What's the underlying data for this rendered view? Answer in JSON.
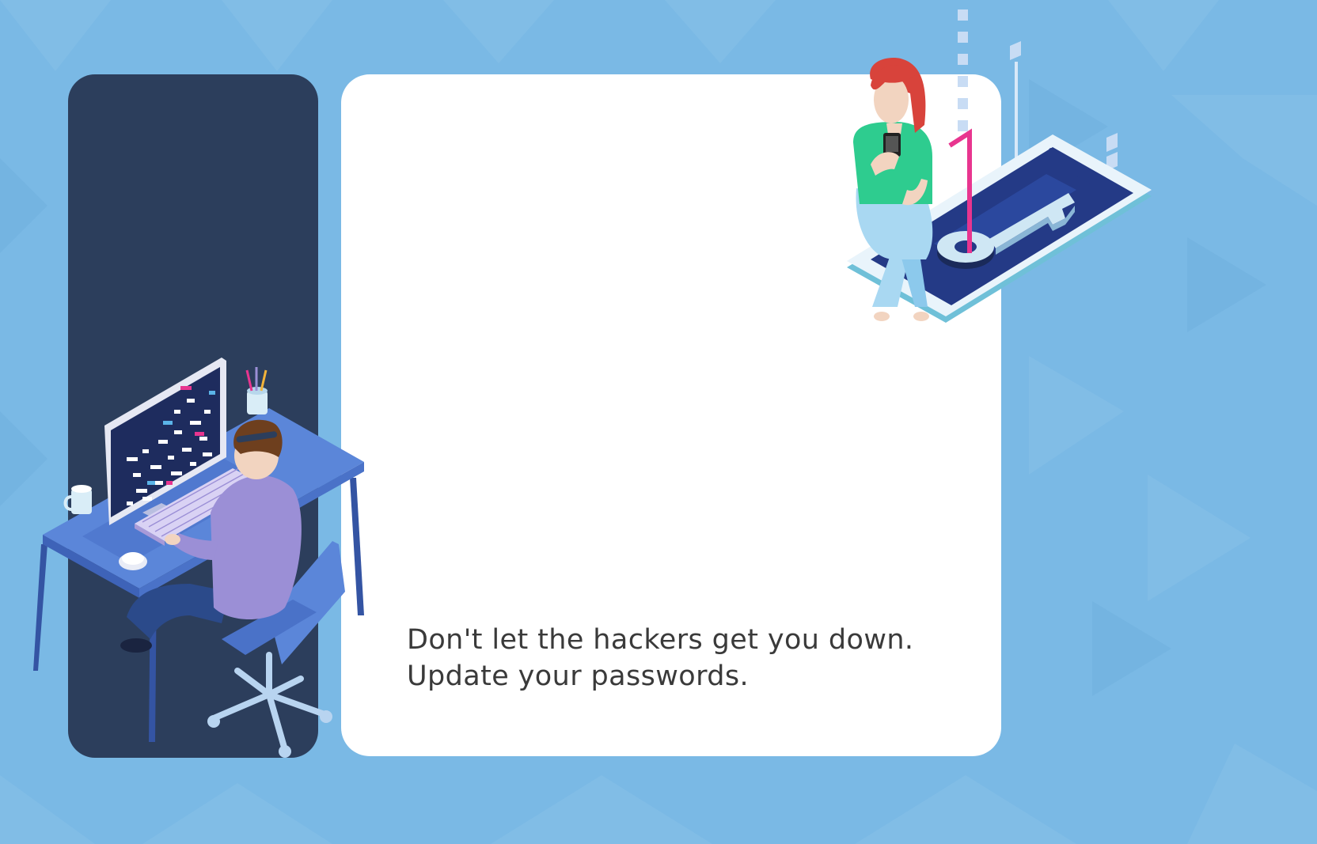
{
  "message": {
    "line1": "Don't let the hackers get you down.",
    "line2": "Update your passwords."
  },
  "colors": {
    "background": "#7ab9e5",
    "panel": "#2c3e5c",
    "card": "#ffffff",
    "text": "#3a3a3a",
    "accent_pink": "#e8358f",
    "shirt_green": "#2ecc8f",
    "jacket_purple": "#9b8fd6"
  },
  "icons": [
    "hacker-desk-illustration",
    "woman-phone-key-illustration"
  ]
}
